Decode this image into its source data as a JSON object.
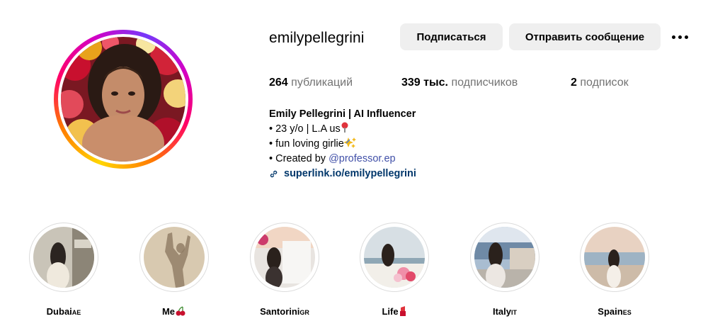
{
  "profile": {
    "username": "emilypellegrini",
    "follow_label": "Подписаться",
    "message_label": "Отправить сообщение",
    "more_icon": "more-horizontal-icon"
  },
  "stats": {
    "posts_count": "264",
    "posts_label": "публикаций",
    "followers_count": "339 тыс.",
    "followers_label": "подписчиков",
    "following_count": "2",
    "following_label": "подписок"
  },
  "bio": {
    "name": "Emily Pellegrini | AI Influencer",
    "line1": "• 23 y/o | L.A us",
    "line2": "• fun loving girlie",
    "line3_prefix": "• Created by ",
    "mention": "@professor.ep",
    "link": "superlink.io/emilypellegrini"
  },
  "highlights": [
    {
      "label": "Dubai",
      "flag": "AE"
    },
    {
      "label": "Me",
      "flag": ""
    },
    {
      "label": "Santorini",
      "flag": "GR"
    },
    {
      "label": "Life",
      "flag": ""
    },
    {
      "label": "Italy",
      "flag": "IT"
    },
    {
      "label": "Spain",
      "flag": "ES"
    }
  ],
  "colors": {
    "button_bg": "#efefef",
    "muted_text": "#737373",
    "link": "#00376b",
    "mention": "#4150a8",
    "highlight_border": "#dbdbdb"
  }
}
